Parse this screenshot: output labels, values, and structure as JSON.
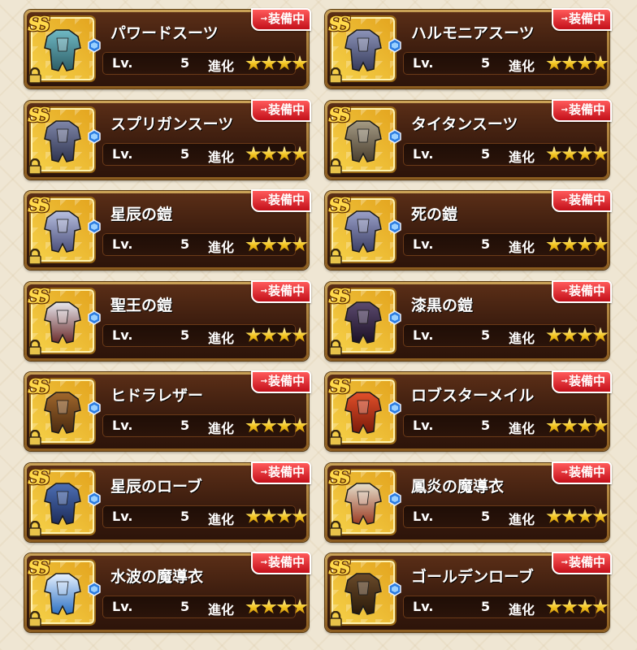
{
  "equip_badge_label": "装備中",
  "rank_label": "SS",
  "lv_label": "Lv.",
  "evolution_label": "進化",
  "colors": {
    "gold": "#f2c21b",
    "badge_red": "#c3101a",
    "panel_brown": "#3b1c0e"
  },
  "items": [
    {
      "name": "パワードスーツ",
      "level": "5",
      "stars": 4,
      "icon": "powered-suit-icon",
      "equipped": true
    },
    {
      "name": "ハルモニアスーツ",
      "level": "5",
      "stars": 4,
      "icon": "harmonia-suit-icon",
      "equipped": true
    },
    {
      "name": "スプリガンスーツ",
      "level": "5",
      "stars": 4,
      "icon": "spriggan-suit-icon",
      "equipped": true
    },
    {
      "name": "タイタンスーツ",
      "level": "5",
      "stars": 4,
      "icon": "titan-suit-icon",
      "equipped": true
    },
    {
      "name": "星辰の鎧",
      "level": "5",
      "stars": 4,
      "icon": "star-armor-icon",
      "equipped": true
    },
    {
      "name": "死の鎧",
      "level": "5",
      "stars": 4,
      "icon": "death-armor-icon",
      "equipped": true
    },
    {
      "name": "聖王の鎧",
      "level": "5",
      "stars": 4,
      "icon": "holy-king-armor-icon",
      "equipped": true
    },
    {
      "name": "漆黒の鎧",
      "level": "5",
      "stars": 4,
      "icon": "jet-black-armor-icon",
      "equipped": true
    },
    {
      "name": "ヒドラレザー",
      "level": "5",
      "stars": 4,
      "icon": "hydra-leather-icon",
      "equipped": true
    },
    {
      "name": "ロブスターメイル",
      "level": "5",
      "stars": 4,
      "icon": "lobster-mail-icon",
      "equipped": true
    },
    {
      "name": "星辰のローブ",
      "level": "5",
      "stars": 4,
      "icon": "star-robe-icon",
      "equipped": true
    },
    {
      "name": "鳳炎の魔導衣",
      "level": "5",
      "stars": 4,
      "icon": "phoenix-flame-robe-icon",
      "equipped": true
    },
    {
      "name": "水波の魔導衣",
      "level": "5",
      "stars": 4,
      "icon": "water-wave-robe-icon",
      "equipped": true
    },
    {
      "name": "ゴールデンローブ",
      "level": "5",
      "stars": 4,
      "icon": "golden-robe-icon",
      "equipped": true
    }
  ]
}
